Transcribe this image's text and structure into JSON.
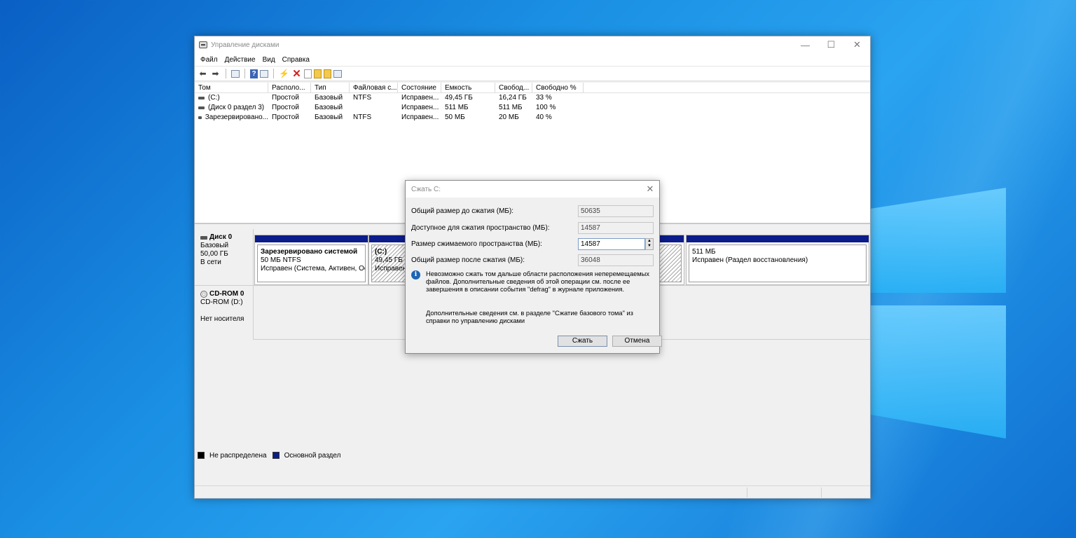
{
  "window": {
    "title": "Управление дисками",
    "controls": [
      "—",
      "☐",
      "✕"
    ]
  },
  "menu": [
    "Файл",
    "Действие",
    "Вид",
    "Справка"
  ],
  "volume_table": {
    "headers": [
      "Том",
      "Располо...",
      "Тип",
      "Файловая с...",
      "Состояние",
      "Емкость",
      "Свобод...",
      "Свободно %"
    ],
    "rows": [
      [
        "(C:)",
        "Простой",
        "Базовый",
        "NTFS",
        "Исправен...",
        "49,45 ГБ",
        "16,24 ГБ",
        "33 %"
      ],
      [
        "(Диск 0 раздел 3)",
        "Простой",
        "Базовый",
        "",
        "Исправен...",
        "511 МБ",
        "511 МБ",
        "100 %"
      ],
      [
        "Зарезервировано...",
        "Простой",
        "Базовый",
        "NTFS",
        "Исправен...",
        "50 МБ",
        "20 МБ",
        "40 %"
      ]
    ]
  },
  "disks": {
    "disk0": {
      "name": "Диск 0",
      "type": "Базовый",
      "size": "50,00 ГБ",
      "status": "В сети",
      "partitions": [
        {
          "title": "Зарезервировано системой",
          "size": "50 МБ NTFS",
          "status": "Исправен (Система, Активен, Осн"
        },
        {
          "title": "(C:)",
          "size": "49,45 ГБ NT",
          "status": "Исправен"
        },
        {
          "title": "",
          "size": "511 МБ",
          "status": "Исправен (Раздел восстановления)"
        }
      ]
    },
    "cdrom": {
      "name": "CD-ROM 0",
      "type": "CD-ROM (D:)",
      "status": "Нет носителя"
    }
  },
  "legend": {
    "unallocated": "Не распределена",
    "primary": "Основной раздел"
  },
  "colors": {
    "primary_partition": "#0c1c8a",
    "unallocated": "#000000",
    "info_icon": "#1c65b5"
  },
  "dialog": {
    "title": "Сжать C:",
    "fields": {
      "total_before_label": "Общий размер до сжатия (МБ):",
      "total_before_value": "50635",
      "available_label": "Доступное для сжатия пространство (МБ):",
      "available_value": "14587",
      "shrink_label": "Размер сжимаемого пространства (МБ):",
      "shrink_value": "14587",
      "total_after_label": "Общий размер после сжатия (МБ):",
      "total_after_value": "36048"
    },
    "info_text": "Невозможно сжать том дальше области расположения неперемещаемых файлов. Дополнительные сведения об этой операции см. после ее завершения в описании события \"defrag\" в журнале приложения.",
    "more_text": "Дополнительные сведения см. в разделе \"Сжатие базового тома\" из справки по управлению дисками",
    "shrink_button": "Сжать",
    "cancel_button": "Отмена"
  }
}
